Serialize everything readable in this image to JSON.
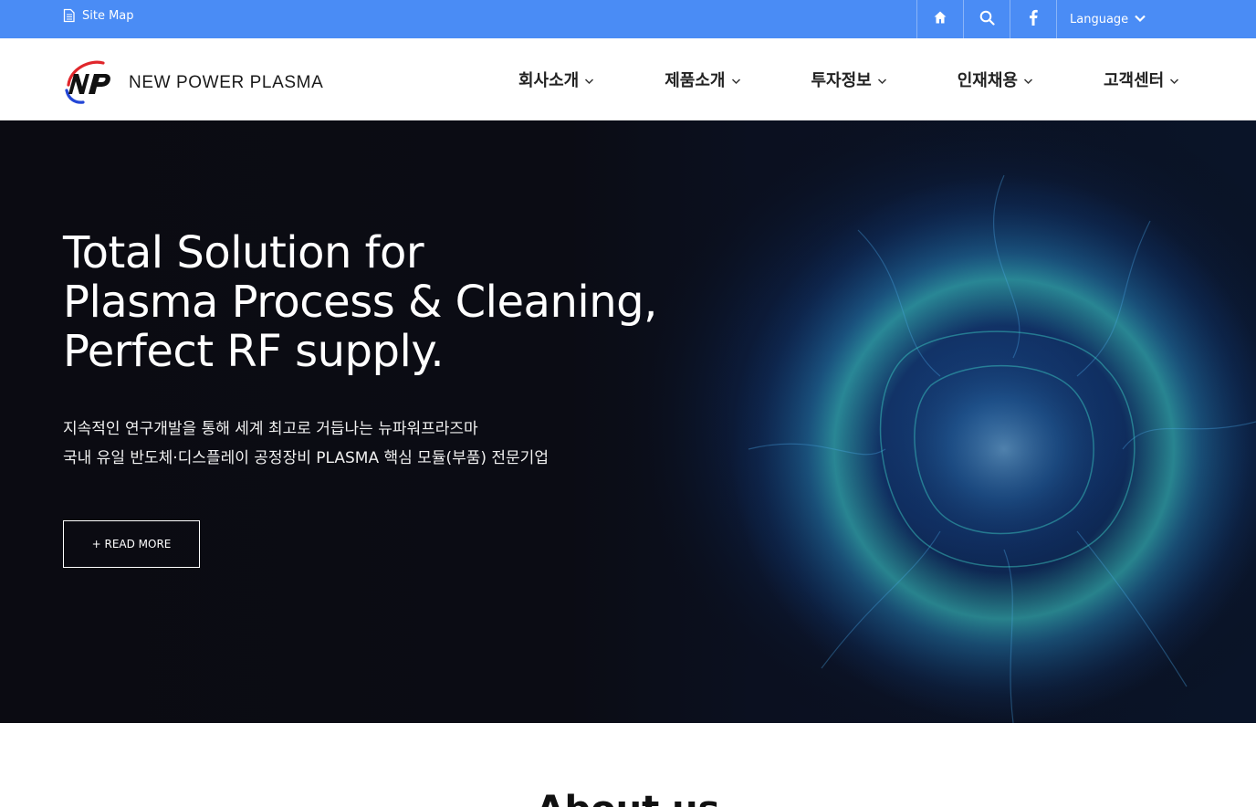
{
  "topbar": {
    "sitemap_label": "Site Map",
    "language_label": "Language",
    "icons": [
      "document-icon",
      "home-icon",
      "search-icon",
      "facebook-icon",
      "chevron-down-icon"
    ]
  },
  "header": {
    "logo_text": "NEW POWER PLASMA",
    "nav": [
      {
        "label": "회사소개"
      },
      {
        "label": "제품소개"
      },
      {
        "label": "투자정보"
      },
      {
        "label": "인재채용"
      },
      {
        "label": "고객센터"
      }
    ]
  },
  "hero": {
    "title_lines": [
      "Total Solution for",
      "Plasma Process & Cleaning,",
      "Perfect RF supply."
    ],
    "subtitle_lines": [
      "지속적인 연구개발을 통해 세계 최고로 거듭나는 뉴파워프라즈마",
      "국내 유일 반도체·디스플레이 공정장비 PLASMA 핵심 모듈(부품) 전문기업"
    ],
    "button_label": "+ READ MORE"
  },
  "about": {
    "title": "About us"
  },
  "colors": {
    "topbar": "#4a8cf5",
    "hero_bg": "#0b0b12",
    "plasma_accent": "#3fd3c8",
    "logo_red": "#e0262b",
    "logo_blue": "#2346d6"
  }
}
